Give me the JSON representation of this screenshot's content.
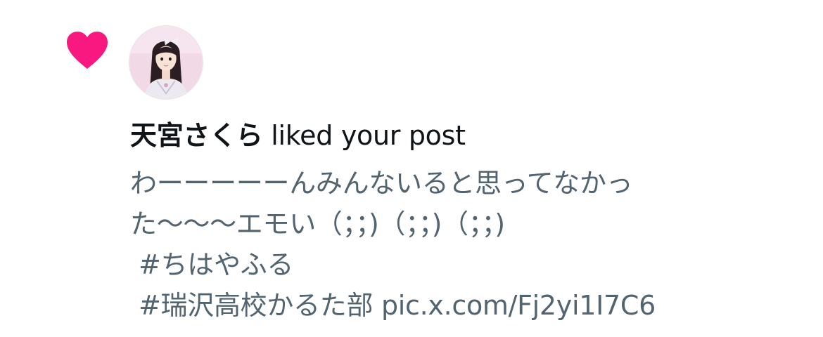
{
  "notification": {
    "type_icon": "heart-icon",
    "heart_color": "#F91880",
    "avatar_alt": "profile photo",
    "username": "天宮さくら",
    "action": "liked your post",
    "post": {
      "line1": "わーーーーーんみんないると思ってなかっ",
      "line2": "た〜〜〜エモい（；；)（；；)（；；)",
      "hashtag1": "#ちはやふる",
      "hashtag2": "#瑞沢高校かるた部",
      "link": "pic.x.com/Fj2yi1I7C6"
    }
  }
}
